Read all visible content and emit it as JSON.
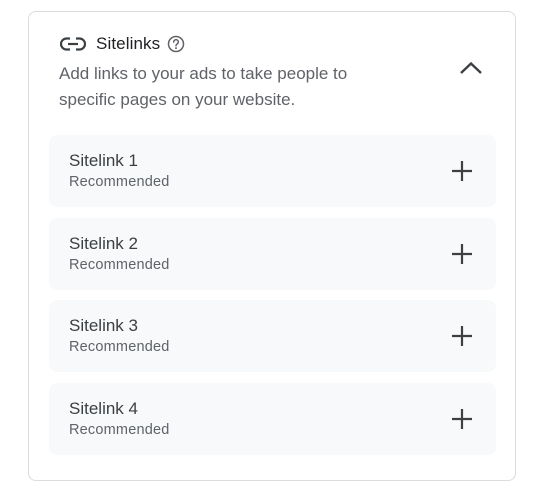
{
  "section": {
    "title": "Sitelinks",
    "description": "Add links to your ads to take people to specific pages on your website.",
    "icons": {
      "title": "link-icon",
      "help": "help-circle-icon",
      "toggle": "chevron-up-icon"
    }
  },
  "sitelinks": [
    {
      "label": "Sitelink 1",
      "sublabel": "Recommended",
      "action_icon": "add-icon"
    },
    {
      "label": "Sitelink 2",
      "sublabel": "Recommended",
      "action_icon": "add-icon"
    },
    {
      "label": "Sitelink 3",
      "sublabel": "Recommended",
      "action_icon": "add-icon"
    },
    {
      "label": "Sitelink 4",
      "sublabel": "Recommended",
      "action_icon": "add-icon"
    }
  ],
  "colors": {
    "border": "#dadce0",
    "item_background": "#f8f9fa",
    "text_primary": "#202124",
    "text_secondary": "#5f6368",
    "icon": "#3c4043"
  }
}
